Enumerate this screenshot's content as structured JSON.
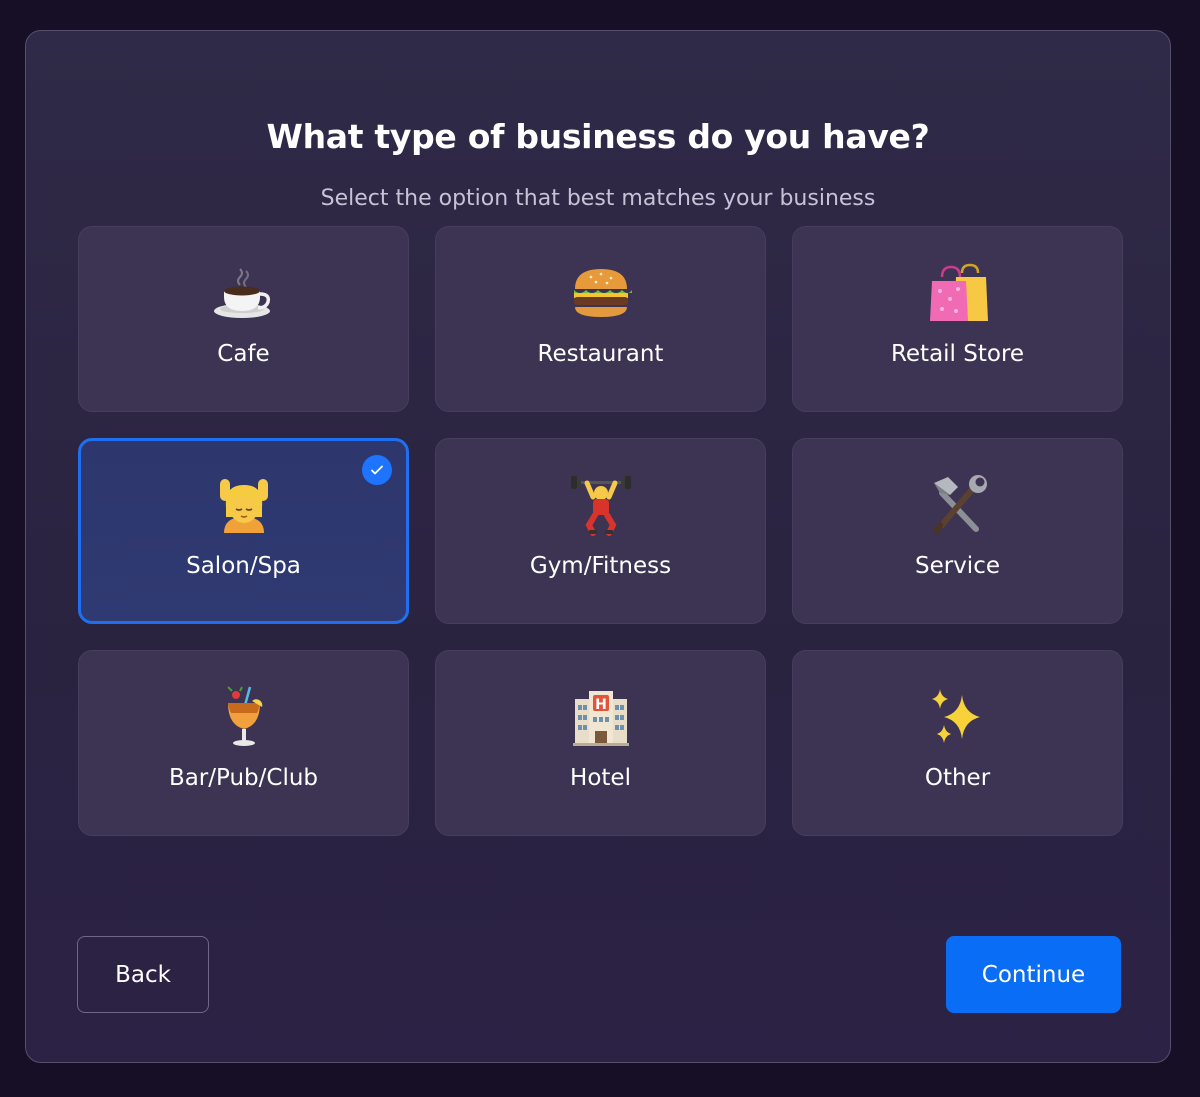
{
  "header": {
    "title": "What type of business do you have?",
    "subtitle": "Select the option that best matches your business"
  },
  "options": [
    {
      "label": "Cafe",
      "icon": "coffee-cup-icon",
      "selected": false
    },
    {
      "label": "Restaurant",
      "icon": "burger-icon",
      "selected": false
    },
    {
      "label": "Retail Store",
      "icon": "shopping-bags-icon",
      "selected": false
    },
    {
      "label": "Salon/Spa",
      "icon": "head-massage-icon",
      "selected": true
    },
    {
      "label": "Gym/Fitness",
      "icon": "weightlifter-icon",
      "selected": false
    },
    {
      "label": "Service",
      "icon": "hammer-wrench-icon",
      "selected": false
    },
    {
      "label": "Bar/Pub/Club",
      "icon": "tropical-drink-icon",
      "selected": false
    },
    {
      "label": "Hotel",
      "icon": "hotel-icon",
      "selected": false
    },
    {
      "label": "Other",
      "icon": "sparkles-icon",
      "selected": false
    }
  ],
  "footer": {
    "back_label": "Back",
    "continue_label": "Continue"
  },
  "colors": {
    "accent": "#0a6df5",
    "selected_border": "#1f6ff0",
    "card_bg": "#3c3452",
    "modal_bg": "#2d2744",
    "page_bg": "#170f26"
  }
}
